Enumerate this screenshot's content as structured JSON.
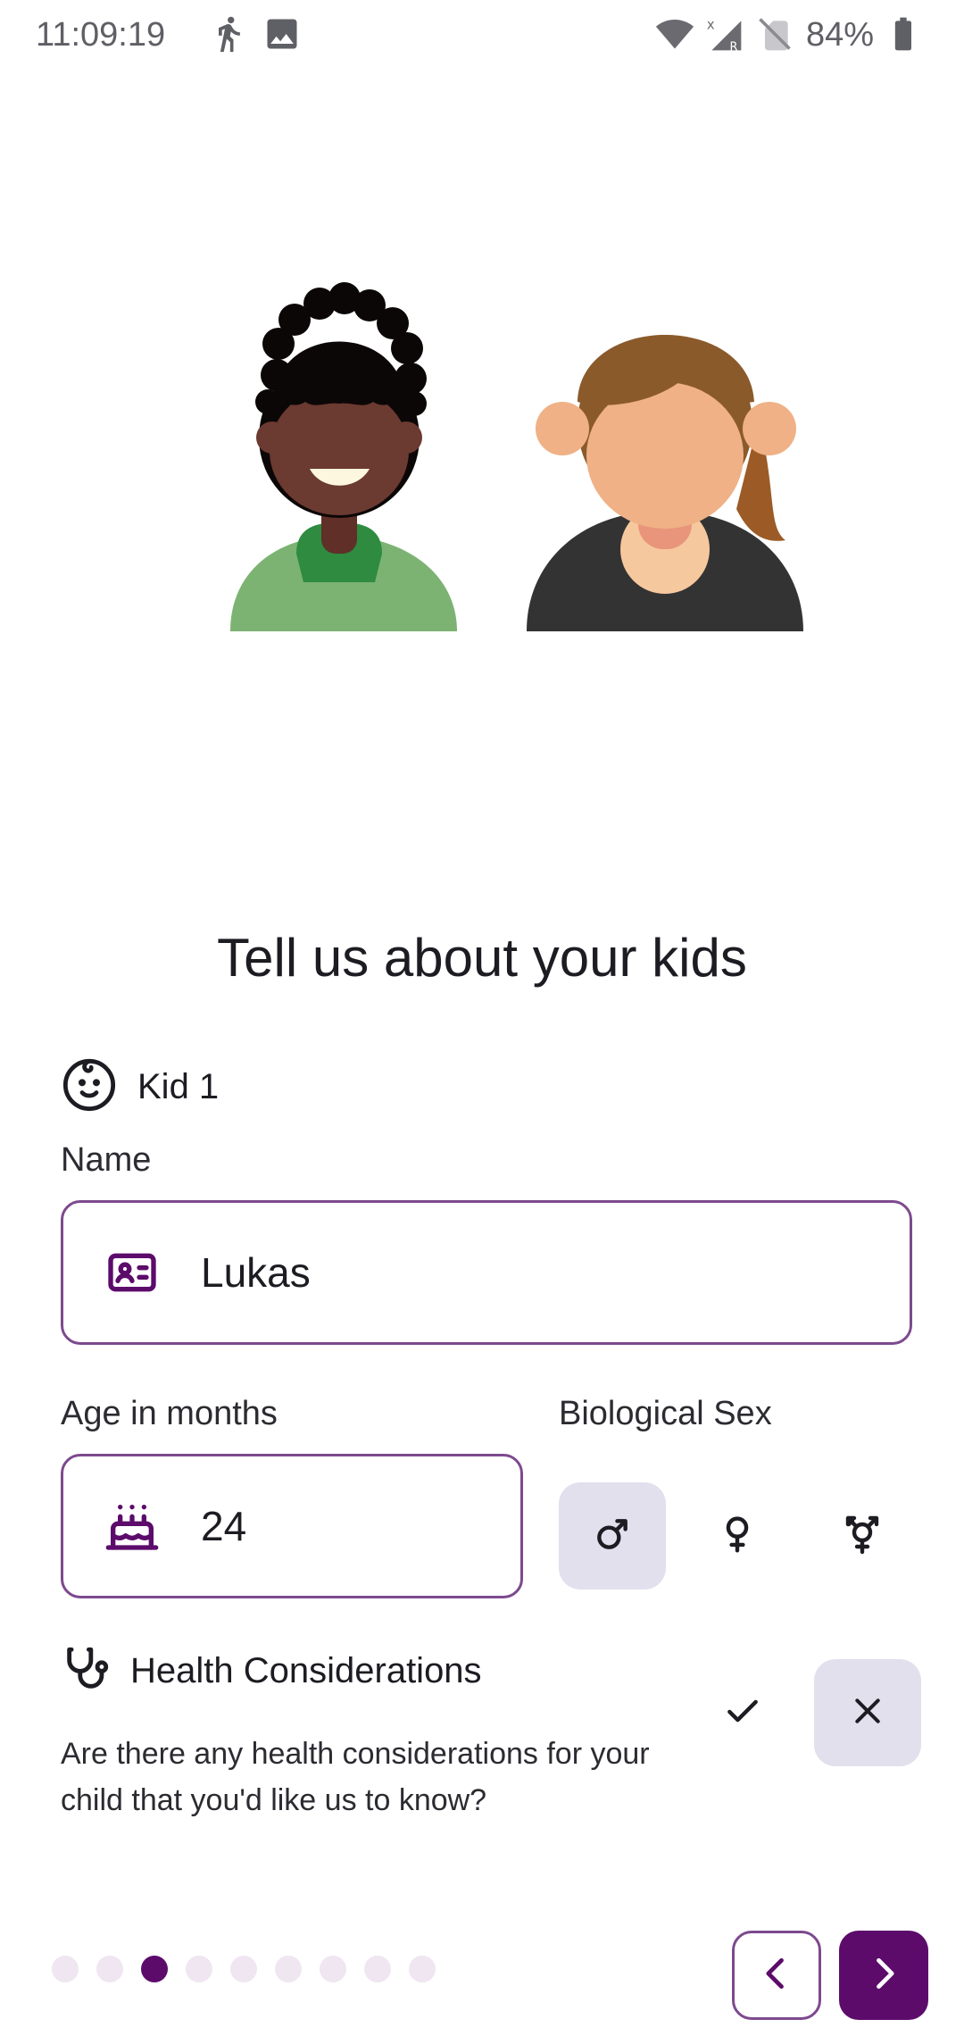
{
  "status_bar": {
    "time": "11:09:19",
    "battery": "84%"
  },
  "page": {
    "title": "Tell us about your kids"
  },
  "kid": {
    "label": "Kid 1",
    "name_label": "Name",
    "name_value": "Lukas",
    "age_label": "Age in months",
    "age_value": "24",
    "sex_label": "Biological Sex",
    "sex_selected": "male"
  },
  "health": {
    "title": "Health Considerations",
    "description": "Are there any health considerations for your child that you'd like us to know?",
    "selected": "no"
  },
  "pagination": {
    "total": 9,
    "current": 3
  },
  "colors": {
    "accent": "#5c0b6b",
    "border": "#7d4a8e",
    "selected_bg": "#e3e0ee",
    "dot_inactive": "#efe6f1"
  }
}
